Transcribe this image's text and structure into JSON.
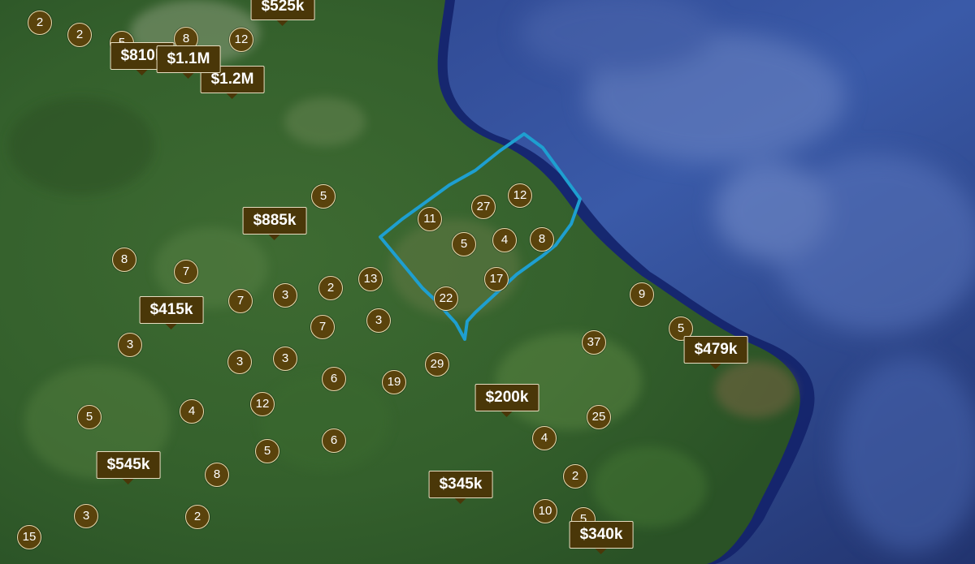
{
  "map": {
    "boundary_color": "#1e9fd0",
    "marker_color": "#4a3708",
    "clusters": [
      {
        "label": "2"
      },
      {
        "label": "2"
      },
      {
        "label": "5"
      },
      {
        "label": "8"
      },
      {
        "label": "12"
      },
      {
        "label": "5"
      },
      {
        "label": "27"
      },
      {
        "label": "12"
      },
      {
        "label": "11"
      },
      {
        "label": "5"
      },
      {
        "label": "4"
      },
      {
        "label": "8"
      },
      {
        "label": "8"
      },
      {
        "label": "7"
      },
      {
        "label": "13"
      },
      {
        "label": "17"
      },
      {
        "label": "2"
      },
      {
        "label": "7"
      },
      {
        "label": "3"
      },
      {
        "label": "22"
      },
      {
        "label": "9"
      },
      {
        "label": "7"
      },
      {
        "label": "3"
      },
      {
        "label": "5"
      },
      {
        "label": "3"
      },
      {
        "label": "37"
      },
      {
        "label": "3"
      },
      {
        "label": "3"
      },
      {
        "label": "29"
      },
      {
        "label": "6"
      },
      {
        "label": "19"
      },
      {
        "label": "12"
      },
      {
        "label": "4"
      },
      {
        "label": "5"
      },
      {
        "label": "25"
      },
      {
        "label": "6"
      },
      {
        "label": "4"
      },
      {
        "label": "5"
      },
      {
        "label": "8"
      },
      {
        "label": "2"
      },
      {
        "label": "3"
      },
      {
        "label": "2"
      },
      {
        "label": "10"
      },
      {
        "label": "5"
      },
      {
        "label": "15"
      }
    ],
    "price_tags": [
      {
        "label": "$525k"
      },
      {
        "label": "$810k"
      },
      {
        "label": "$1.1M"
      },
      {
        "label": "$1.2M"
      },
      {
        "label": "$885k"
      },
      {
        "label": "$415k"
      },
      {
        "label": "$479k"
      },
      {
        "label": "$200k"
      },
      {
        "label": "$545k"
      },
      {
        "label": "$345k"
      },
      {
        "label": "$340k"
      }
    ]
  }
}
